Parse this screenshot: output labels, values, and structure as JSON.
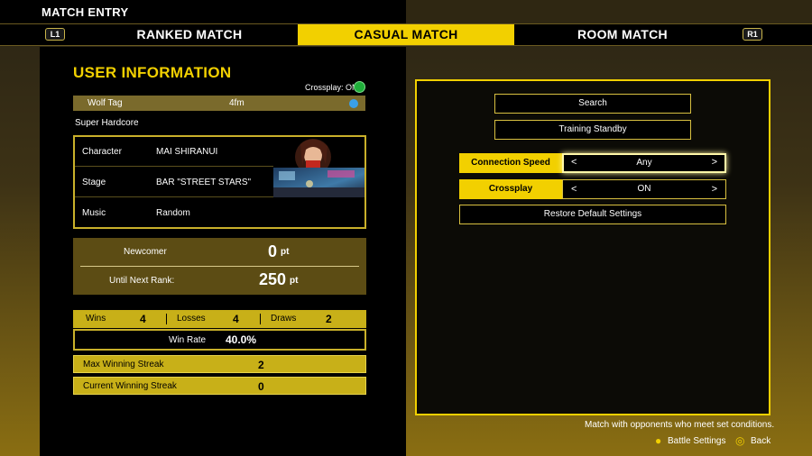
{
  "header": {
    "title": "MATCH ENTRY"
  },
  "tabs": [
    {
      "label": "RANKED MATCH",
      "active": false
    },
    {
      "label": "CASUAL MATCH",
      "active": true
    },
    {
      "label": "ROOM MATCH",
      "active": false
    }
  ],
  "shoulder": {
    "left": "L1",
    "right": "R1"
  },
  "user": {
    "section_title": "USER INFORMATION",
    "crossplay_status": "Crossplay: ON",
    "tag_label": "Wolf Tag",
    "tag_value": "4fm",
    "title": "Super Hardcore",
    "loadout": [
      {
        "key": "Character",
        "value": "MAI SHIRANUI"
      },
      {
        "key": "Stage",
        "value": "BAR \"STREET STARS\""
      },
      {
        "key": "Music",
        "value": "Random"
      }
    ],
    "rank": {
      "name": "Newcomer",
      "points": "0",
      "unit": "pt",
      "next_label": "Until Next Rank:",
      "next_points": "250",
      "next_unit": "pt"
    },
    "stats": {
      "wins_label": "Wins",
      "wins": "4",
      "losses_label": "Losses",
      "losses": "4",
      "draws_label": "Draws",
      "draws": "2",
      "winrate_label": "Win Rate",
      "winrate": "40.0%",
      "max_streak_label": "Max Winning Streak",
      "max_streak": "2",
      "cur_streak_label": "Current Winning Streak",
      "cur_streak": "0"
    }
  },
  "actions": {
    "search": "Search",
    "training": "Training Standby",
    "connection_label": "Connection Speed",
    "connection_value": "Any",
    "crossplay_label": "Crossplay",
    "crossplay_value": "ON",
    "restore": "Restore Default Settings",
    "arrow_left": "<",
    "arrow_right": ">"
  },
  "footer": {
    "hint": "Match with opponents who meet set conditions.",
    "battle_settings": "Battle Settings",
    "back": "Back"
  },
  "colors": {
    "accent": "#f2d000",
    "panel": "#000000",
    "stat_bar": "#c8b018"
  }
}
